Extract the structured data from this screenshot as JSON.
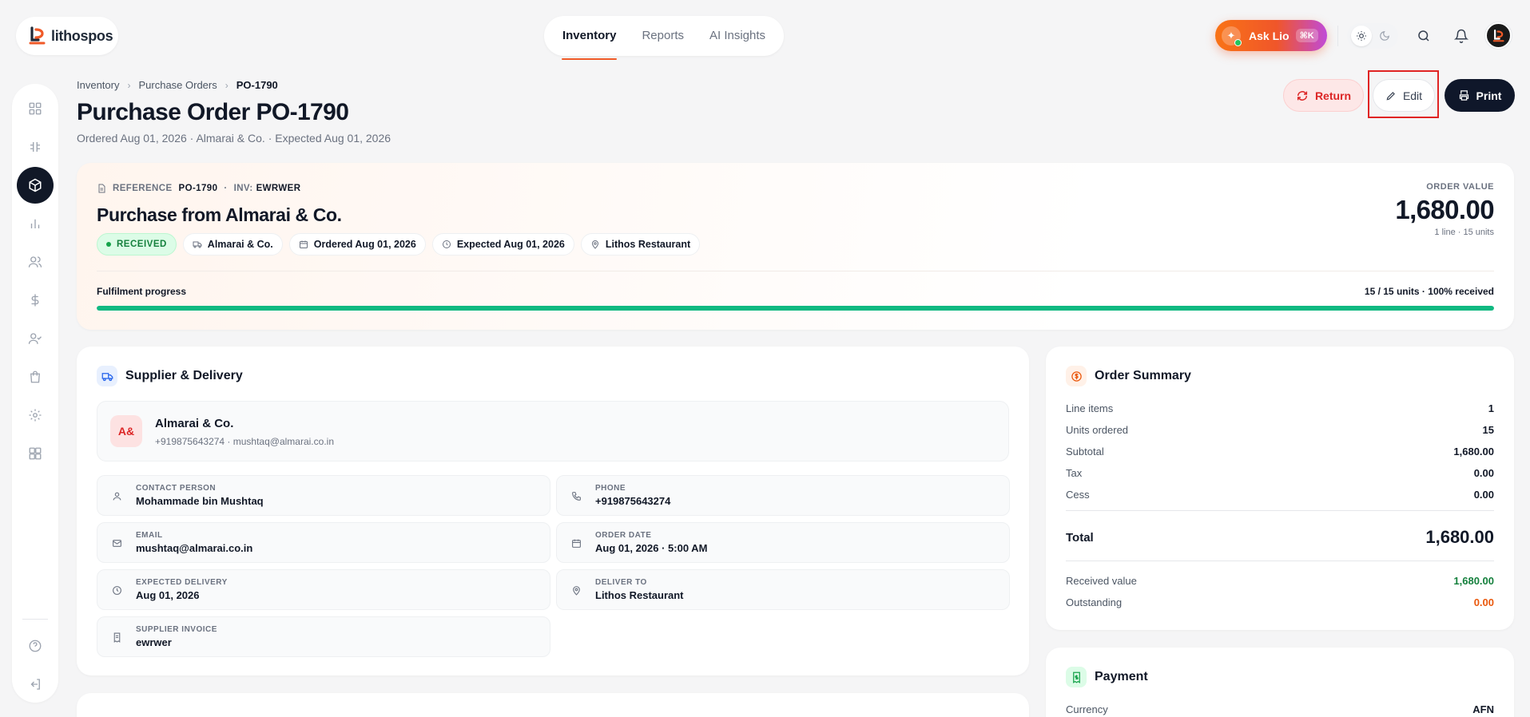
{
  "app": {
    "name": "lithospos"
  },
  "topnav": {
    "tabs": [
      {
        "label": "Inventory"
      },
      {
        "label": "Reports"
      },
      {
        "label": "AI Insights"
      }
    ]
  },
  "header_right": {
    "ask_label": "Ask Lio",
    "ask_shortcut": "⌘K"
  },
  "breadcrumb": {
    "items": [
      "Inventory",
      "Purchase Orders",
      "PO-1790"
    ]
  },
  "page": {
    "title": "Purchase Order PO-1790",
    "subtitle": "Ordered Aug 01, 2026 · Almarai & Co. · Expected Aug 01, 2026"
  },
  "actions": {
    "return_label": "Return",
    "edit_label": "Edit",
    "print_label": "Print"
  },
  "hero": {
    "reference_label": "REFERENCE",
    "reference_value": "PO-1790",
    "dot": "·",
    "inv_label": "INV:",
    "inv_value": "EWRWER",
    "title": "Purchase from Almarai & Co.",
    "status": "RECEIVED",
    "chips": {
      "supplier": "Almarai & Co.",
      "ordered": "Ordered Aug 01, 2026",
      "expected": "Expected Aug 01, 2026",
      "location": "Lithos Restaurant"
    },
    "order_value_label": "ORDER VALUE",
    "order_value": "1,680.00",
    "order_value_sub": "1 line · 15 units",
    "progress_label": "Fulfilment progress",
    "progress_text": "15 / 15 units · 100% received",
    "progress_fraction": 1.0
  },
  "supplier_card": {
    "title": "Supplier & Delivery",
    "initials": "A&",
    "name": "Almarai & Co.",
    "contact_line": "+919875643274 · mushtaq@almarai.co.in",
    "fields": {
      "contact_label": "CONTACT PERSON",
      "contact_value": "Mohammade bin Mushtaq",
      "phone_label": "PHONE",
      "phone_value": "+919875643274",
      "email_label": "EMAIL",
      "email_value": "mushtaq@almarai.co.in",
      "order_date_label": "ORDER DATE",
      "order_date_value": "Aug 01, 2026 · 5:00 AM",
      "expected_label": "EXPECTED DELIVERY",
      "expected_value": "Aug 01, 2026",
      "deliver_label": "DELIVER TO",
      "deliver_value": "Lithos Restaurant",
      "invoice_label": "SUPPLIER INVOICE",
      "invoice_value": "ewrwer"
    }
  },
  "summary": {
    "title": "Order Summary",
    "rows": [
      {
        "label": "Line items",
        "value": "1"
      },
      {
        "label": "Units ordered",
        "value": "15"
      },
      {
        "label": "Subtotal",
        "value": "1,680.00"
      },
      {
        "label": "Tax",
        "value": "0.00"
      },
      {
        "label": "Cess",
        "value": "0.00"
      }
    ],
    "total_label": "Total",
    "total_value": "1,680.00",
    "received_label": "Received value",
    "received_value": "1,680.00",
    "outstanding_label": "Outstanding",
    "outstanding_value": "0.00"
  },
  "payment": {
    "title": "Payment",
    "currency_label": "Currency",
    "currency_value": "AFN"
  },
  "colors": {
    "accent": "#f05a28",
    "success": "#10b981",
    "danger": "#dc2626",
    "dark": "#0f172a",
    "warning": "#ea580c"
  }
}
